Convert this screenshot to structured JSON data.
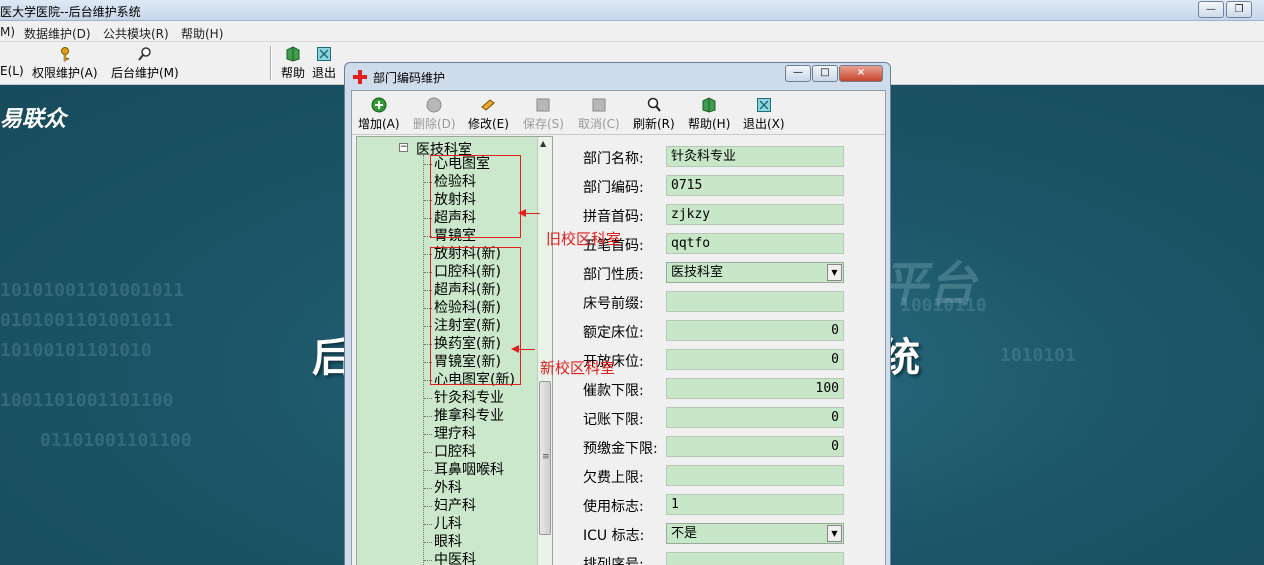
{
  "main_window": {
    "title": "医大学医院--后台维护系统",
    "controls": {
      "minimize": "—",
      "restore": "❐"
    }
  },
  "menubar": {
    "items": [
      "M)",
      "数据维护(D)",
      "公共模块(R)",
      "帮助(H)"
    ]
  },
  "toolbar": {
    "items": [
      "E(L)",
      "权限维护(A)",
      "后台维护(M)"
    ],
    "help": "帮助",
    "exit": "退出"
  },
  "desktop": {
    "logo": "易联众",
    "char_left": "后",
    "char_right": "统",
    "watermark": "平台"
  },
  "dialog": {
    "title": "部门编码维护",
    "controls": {
      "minimize": "—",
      "maximize": "□",
      "close": "×"
    },
    "toolbar": [
      {
        "label": "增加(A)",
        "enabled": true,
        "icon": "add-icon"
      },
      {
        "label": "删除(D)",
        "enabled": false,
        "icon": "delete-icon"
      },
      {
        "label": "修改(E)",
        "enabled": true,
        "icon": "edit-icon"
      },
      {
        "label": "保存(S)",
        "enabled": false,
        "icon": "save-icon"
      },
      {
        "label": "取消(C)",
        "enabled": false,
        "icon": "cancel-icon"
      },
      {
        "label": "刷新(R)",
        "enabled": true,
        "icon": "refresh-icon"
      },
      {
        "label": "帮助(H)",
        "enabled": true,
        "icon": "help-icon"
      },
      {
        "label": "退出(X)",
        "enabled": true,
        "icon": "exit-icon"
      }
    ]
  },
  "tree": {
    "root": "医技科室",
    "items": [
      "心电图室",
      "检验科",
      "放射科",
      "超声科",
      "胃镜室",
      "放射科(新)",
      "口腔科(新)",
      "超声科(新)",
      "检验科(新)",
      "注射室(新)",
      "换药室(新)",
      "胃镜室(新)",
      "心电图室(新)",
      "针灸科专业",
      "推拿科专业",
      "理疗科",
      "口腔科",
      "耳鼻咽喉科",
      "外科",
      "妇产科",
      "儿科",
      "眼科",
      "中医科"
    ]
  },
  "annotations": {
    "old_campus": "旧校区科室",
    "new_campus": "新校区科室"
  },
  "form": {
    "fields": [
      {
        "label": "部门名称:",
        "value": "针灸科专业",
        "type": "text"
      },
      {
        "label": "部门编码:",
        "value": "0715",
        "type": "text"
      },
      {
        "label": "拼音首码:",
        "value": "zjkzy",
        "type": "text"
      },
      {
        "label": "五笔首码:",
        "value": "qqtfo",
        "type": "text"
      },
      {
        "label": "部门性质:",
        "value": "医技科室",
        "type": "select"
      },
      {
        "label": "床号前缀:",
        "value": "",
        "type": "text"
      },
      {
        "label": "额定床位:",
        "value": "0",
        "type": "num"
      },
      {
        "label": "开放床位:",
        "value": "0",
        "type": "num"
      },
      {
        "label": "催款下限:",
        "value": "100",
        "type": "num"
      },
      {
        "label": "记账下限:",
        "value": "0",
        "type": "num"
      },
      {
        "label": "预缴金下限:",
        "value": "0",
        "type": "num"
      },
      {
        "label": "欠费上限:",
        "value": "",
        "type": "text"
      },
      {
        "label": "使用标志:",
        "value": "1",
        "type": "text"
      },
      {
        "label": "ICU 标志:",
        "value": "不是",
        "type": "select"
      },
      {
        "label": "排列序号:",
        "value": "",
        "type": "text"
      }
    ]
  }
}
